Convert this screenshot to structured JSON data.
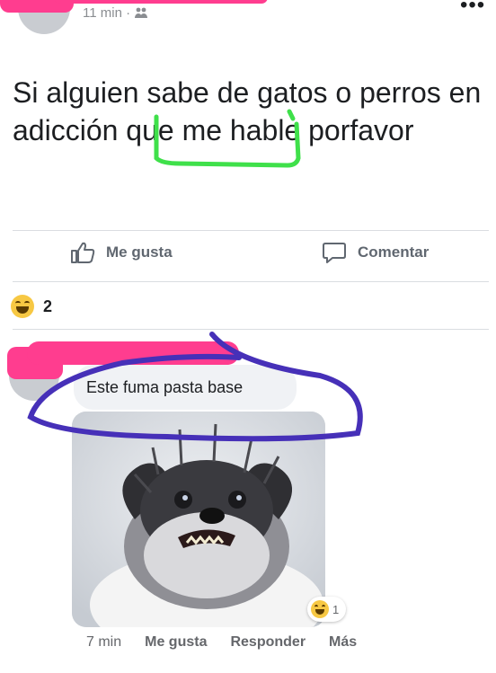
{
  "post": {
    "time": "11 min ·",
    "privacy_icon": "friends-icon",
    "text": "Si alguien sabe de gatos o perros en adicción que me hable porfavor"
  },
  "actions": {
    "like_label": "Me gusta",
    "comment_label": "Comentar"
  },
  "reactions": {
    "emoji": "haha-emoji",
    "count": "2"
  },
  "comment": {
    "text": "Este fuma pasta base",
    "image_reaction_count": "1",
    "time": "7 min",
    "like_label": "Me gusta",
    "reply_label": "Responder",
    "more_label": "Más"
  },
  "colors": {
    "scribble_pink": "#ff3d8f",
    "green_mark": "#3fe04a",
    "blue_mark": "#4630b8"
  }
}
